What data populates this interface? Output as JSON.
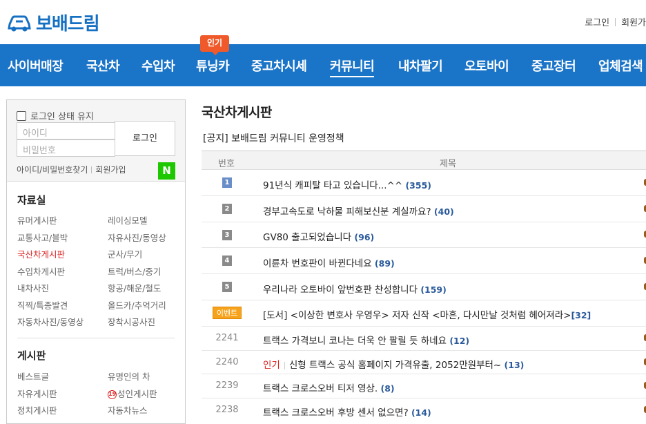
{
  "header": {
    "logo_text": "보배드림",
    "top_links": [
      "로그인",
      "회원가"
    ]
  },
  "nav": {
    "hot_badge": "인기",
    "items": [
      "사이버매장",
      "국산차",
      "수입차",
      "튜닝카",
      "중고차시세",
      "커뮤니티",
      "내차팔기",
      "오토바이",
      "중고장터",
      "업체검색"
    ]
  },
  "sidebar": {
    "keep_login": "로그인 상태 유지",
    "id_placeholder": "아이디",
    "pw_placeholder": "비밀번호",
    "login_button": "로그인",
    "find_link": "아이디/비밀번호찾기",
    "join_link": "회원가입",
    "naver": "N",
    "archive_title": "자료실",
    "archive_left": [
      "유머게시판",
      "교통사고/블박",
      "국산차게시판",
      "수입차게시판",
      "내차사진",
      "직찍/특종발견",
      "자동차사진/동영상"
    ],
    "archive_right": [
      "레이싱모델",
      "자유사진/동영상",
      "군사/무기",
      "트럭/버스/중기",
      "항공/해운/철도",
      "올드카/추억거리",
      "장착시공사진"
    ],
    "board_title": "게시판",
    "board_left": [
      "베스트글",
      "자유게시판",
      "정치게시판"
    ],
    "board_right": [
      "유명인의 차",
      "성인게시판",
      "자동차뉴스"
    ],
    "adult_mark": "19"
  },
  "main": {
    "board_title": "국산차게시판",
    "notice": "[공지] 보배드림 커뮤니티 운영정책",
    "col_num": "번호",
    "col_title": "제목",
    "rows": [
      {
        "num": "1",
        "title": "91년식 캐피탈 타고 있습니다...^^",
        "count": "(355)"
      },
      {
        "num": "2",
        "title": "경부고속도로 낙하물 피해보신분 계실까요?",
        "count": "(40)"
      },
      {
        "num": "3",
        "title": "GV80 출고되었습니다",
        "count": "(96)"
      },
      {
        "num": "4",
        "title": "이륜차 번호판이 바뀐다네요",
        "count": "(89)"
      },
      {
        "num": "5",
        "title": "우리나라 오토바이 앞번호판 찬성합니다",
        "count": "(159)"
      },
      {
        "num": "이벤트",
        "title": "[도서] <이상한 변호사 우영우> 저자 신작 <마흔, 다시만날 것처럼 헤어져라>",
        "count": "[32]"
      },
      {
        "num": "2241",
        "title": "트랙스 가격보니 코나는 더욱 안 팔릴 듯 하네요",
        "count": "(12)"
      },
      {
        "num": "2240",
        "hot": "인기",
        "title": "신형 트랙스 공식 홈페이지 가격유출, 2052만원부터~",
        "count": "(13)"
      },
      {
        "num": "2239",
        "title": "트랙스 크로스오버 티저 영상.",
        "count": "(8)"
      },
      {
        "num": "2238",
        "title": "트랙스 크로스오버 후방 센서 없으면?",
        "count": "(14)"
      }
    ]
  },
  "colors": {
    "nav_bg": "#1a74c8",
    "logo": "#1570c3",
    "hot_badge": "#f05a2a",
    "count": "#2a5a9c",
    "active_link": "#dd2222",
    "naver": "#1ec800",
    "event": "#f7a21b"
  }
}
